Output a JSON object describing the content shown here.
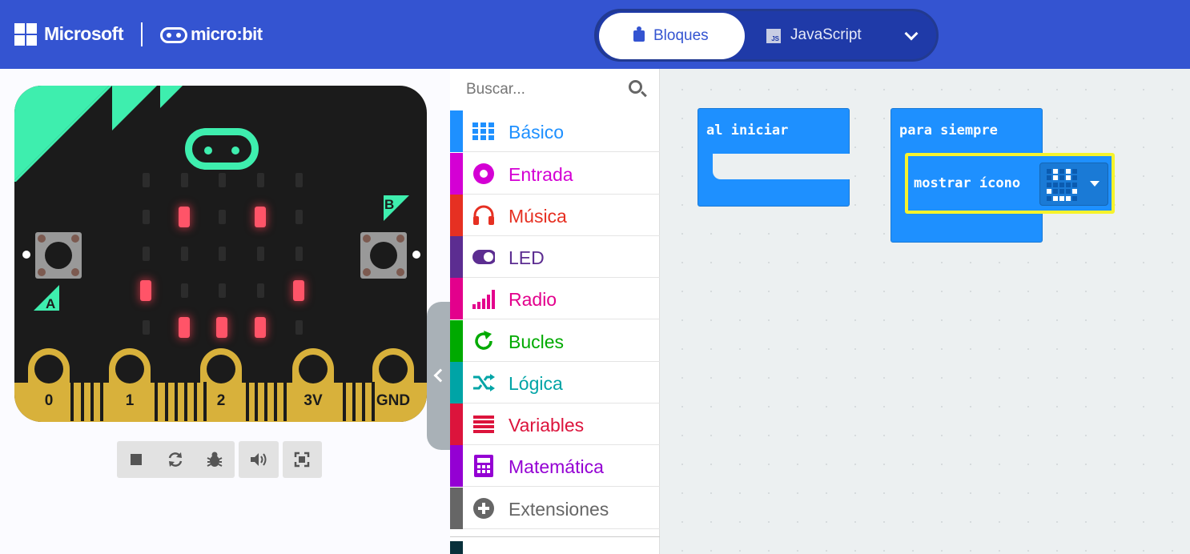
{
  "header": {
    "brand": "Microsoft",
    "product": "micro:bit",
    "tabs": [
      {
        "label": "Bloques",
        "active": true
      },
      {
        "label": "JavaScript",
        "active": false
      }
    ],
    "js_badge": "JS",
    "colors": {
      "bar": "#3454d1",
      "toggle": "#1f3aa8"
    }
  },
  "simulator": {
    "buttons": {
      "a": "A",
      "b": "B"
    },
    "pins": [
      "0",
      "1",
      "2",
      "3V",
      "GND"
    ],
    "led_matrix": [
      [
        0,
        0,
        0,
        0,
        0
      ],
      [
        0,
        1,
        0,
        1,
        0
      ],
      [
        0,
        0,
        0,
        0,
        0
      ],
      [
        1,
        0,
        0,
        0,
        1
      ],
      [
        0,
        1,
        1,
        1,
        0
      ]
    ],
    "toolbar": [
      "stop-icon",
      "restart-icon",
      "debug-icon",
      "sound-icon",
      "fullscreen-icon"
    ]
  },
  "toolbox": {
    "search_placeholder": "Buscar...",
    "categories": [
      {
        "label": "Básico",
        "icon": "grid-icon",
        "color": "#1e90ff"
      },
      {
        "label": "Entrada",
        "icon": "target-icon",
        "color": "#d400d4"
      },
      {
        "label": "Música",
        "icon": "headphones-icon",
        "color": "#e63022"
      },
      {
        "label": "LED",
        "icon": "toggle-icon",
        "color": "#5c2d91"
      },
      {
        "label": "Radio",
        "icon": "signal-icon",
        "color": "#e3008c"
      },
      {
        "label": "Bucles",
        "icon": "refresh-icon",
        "color": "#00aa00"
      },
      {
        "label": "Lógica",
        "icon": "shuffle-icon",
        "color": "#00a4a6"
      },
      {
        "label": "Variables",
        "icon": "list-icon",
        "color": "#dc143c"
      },
      {
        "label": "Matemática",
        "icon": "calculator-icon",
        "color": "#9400d3"
      },
      {
        "label": "Extensiones",
        "icon": "plus-circle-icon",
        "color": "#666666"
      }
    ]
  },
  "workspace": {
    "blocks": {
      "on_start": "al iniciar",
      "forever": "para siempre",
      "show_icon": "mostrar ícono"
    },
    "show_icon_pattern": [
      [
        0,
        1,
        0,
        1,
        0
      ],
      [
        0,
        1,
        0,
        1,
        0
      ],
      [
        0,
        0,
        0,
        0,
        0
      ],
      [
        1,
        0,
        0,
        0,
        1
      ],
      [
        0,
        1,
        1,
        1,
        0
      ]
    ],
    "block_color": "#1e90ff",
    "selected_outline": "#f7f32c"
  }
}
